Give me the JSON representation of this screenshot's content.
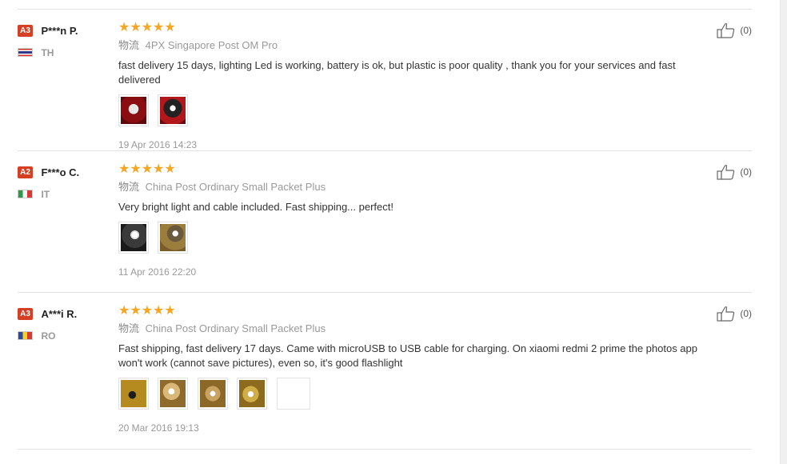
{
  "reviews": [
    {
      "level": "A3",
      "name": "P***n P.",
      "country": "TH",
      "stars": "★★★★★",
      "logistics_label": "物流",
      "logistics": "4PX Singapore Post OM Pro",
      "feedback": "fast delivery 15 days, lighting Led is working, battery is ok, but plastic is poor quality , thank you for your services and fast delivered",
      "date": "19 Apr 2016 14:23",
      "helpful": "(0)"
    },
    {
      "level": "A2",
      "name": "F***o C.",
      "country": "IT",
      "stars": "★★★★★",
      "logistics_label": "物流",
      "logistics": "China Post Ordinary Small Packet Plus",
      "feedback": "Very bright light and cable included. Fast shipping... perfect!",
      "date": "11 Apr 2016 22:20",
      "helpful": "(0)"
    },
    {
      "level": "A3",
      "name": "A***i R.",
      "country": "RO",
      "stars": "★★★★★",
      "logistics_label": "物流",
      "logistics": "China Post Ordinary Small Packet Plus",
      "feedback": "Fast shipping, fast delivery 17 days. Came with microUSB to USB cable for charging. On xiaomi redmi 2 prime the photos app won't work (cannot save pictures), even so, it's good flashlight",
      "date": "20 Mar 2016 19:13",
      "helpful": "(0)"
    }
  ],
  "colors": {
    "level_badge": "#d53f24",
    "stars": "#f5a623",
    "muted_text": "#999999"
  },
  "icons": {
    "helpful": "thumbs-up-icon"
  }
}
